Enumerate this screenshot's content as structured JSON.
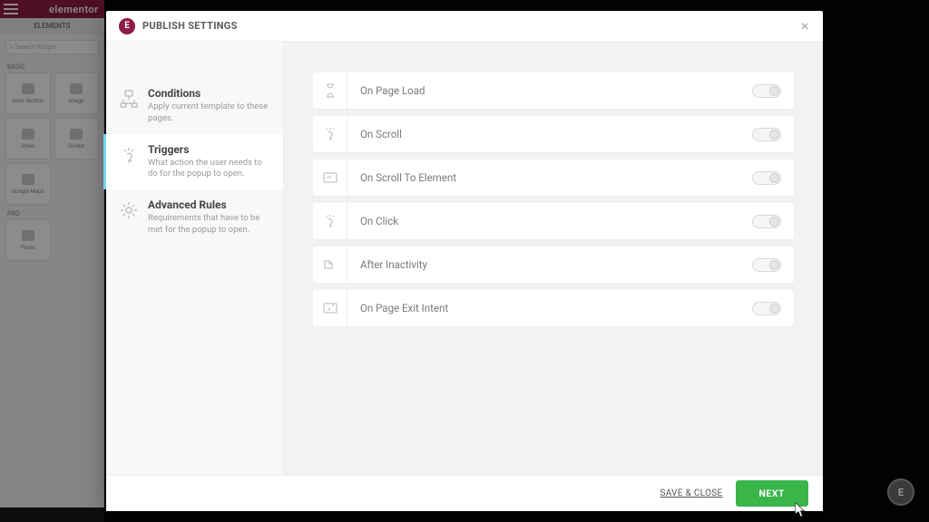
{
  "editor": {
    "brand": "elementor",
    "panel_header": "ELEMENTS",
    "search_placeholder": "Search Widget",
    "section_basic": "BASIC",
    "section_pro": "PRO",
    "widgets_basic": [
      "Inner Section",
      "Image",
      "Video",
      "Divider",
      "Google Maps"
    ],
    "widgets_pro": [
      "Posts"
    ]
  },
  "modal": {
    "title": "PUBLISH SETTINGS",
    "sidebar": [
      {
        "title": "Conditions",
        "desc": "Apply current template to these pages."
      },
      {
        "title": "Triggers",
        "desc": "What action the user needs to do for the popup to open."
      },
      {
        "title": "Advanced Rules",
        "desc": "Requirements that have to be met for the popup to open."
      }
    ],
    "active_sidebar_index": 1,
    "triggers": [
      "On Page Load",
      "On Scroll",
      "On Scroll To Element",
      "On Click",
      "After Inactivity",
      "On Page Exit Intent"
    ],
    "footer": {
      "save_close": "SAVE & CLOSE",
      "next": "NEXT"
    }
  }
}
